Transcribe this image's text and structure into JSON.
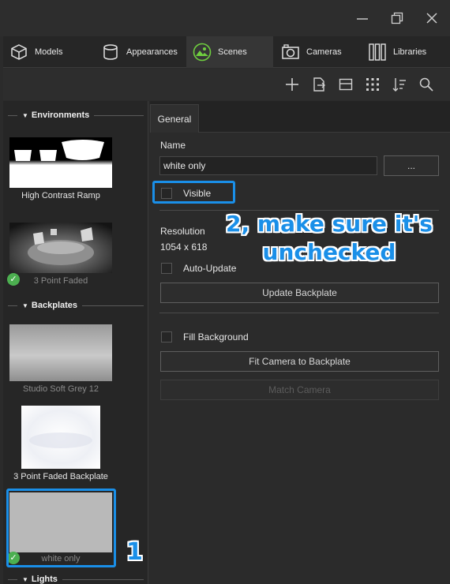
{
  "window": {
    "controls": [
      "minimize-icon",
      "maximize-icon",
      "close-icon"
    ]
  },
  "tabs": [
    {
      "label": "Models",
      "icon": "cube-icon"
    },
    {
      "label": "Appearances",
      "icon": "cylinder-icon"
    },
    {
      "label": "Scenes",
      "icon": "landscape-icon",
      "active": true
    },
    {
      "label": "Cameras",
      "icon": "camera-icon"
    },
    {
      "label": "Libraries",
      "icon": "books-icon"
    }
  ],
  "toolbar": [
    "add-icon",
    "export-icon",
    "layout-icon",
    "grid-view-icon",
    "sort-icon",
    "search-icon"
  ],
  "library": {
    "environments_title": "Environments",
    "backplates_title": "Backplates",
    "lights_title": "Lights",
    "environments": [
      {
        "label": "High Contrast Ramp"
      },
      {
        "label": "3 Point Faded",
        "applied": true
      }
    ],
    "backplates": [
      {
        "label": "Studio Soft Grey 12"
      },
      {
        "label": "3 Point Faded Backplate"
      },
      {
        "label": "white only",
        "applied": true,
        "selected": true
      }
    ]
  },
  "properties": {
    "tab": "General",
    "name_label": "Name",
    "name_value": "white only",
    "browse_button": "...",
    "visible_label": "Visible",
    "visible_checked": false,
    "resolution_label": "Resolution",
    "resolution_value": "1054 x 618",
    "auto_update_label": "Auto-Update",
    "update_backplate": "Update Backplate",
    "fill_background_label": "Fill Background",
    "fit_camera": "Fit Camera to Backplate",
    "match_camera": "Match Camera"
  },
  "annotations": {
    "step1": "1",
    "step2_line1": "2, make sure it's",
    "step2_line2": "unchecked",
    "color": "#1a8fe8"
  }
}
